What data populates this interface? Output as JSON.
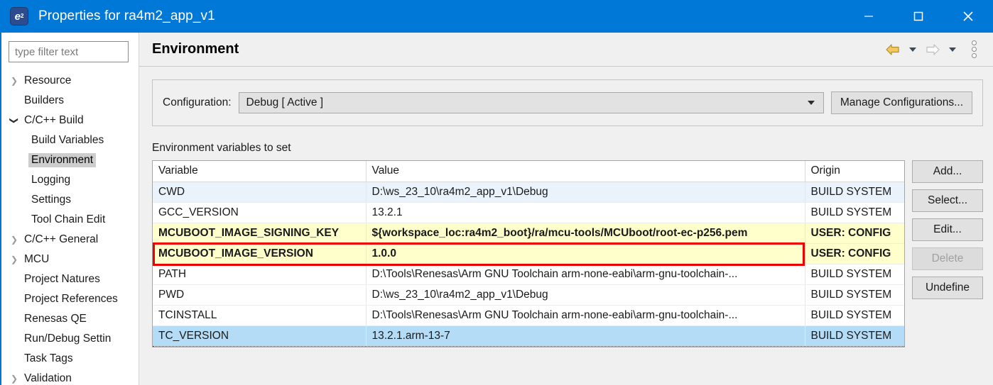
{
  "window": {
    "title": "Properties for ra4m2_app_v1",
    "app_icon": "eclipse-icon",
    "minimize_label": "Minimize",
    "maximize_label": "Maximize",
    "close_label": "Close"
  },
  "sidebar": {
    "filter": {
      "placeholder": "type filter text",
      "value": ""
    },
    "items": [
      {
        "label": "Resource",
        "level": 1,
        "arrow": "collapsed",
        "selected": false
      },
      {
        "label": "Builders",
        "level": 1,
        "arrow": "none",
        "selected": false
      },
      {
        "label": "C/C++ Build",
        "level": 1,
        "arrow": "expanded",
        "selected": false
      },
      {
        "label": "Build Variables",
        "level": 2,
        "arrow": "none",
        "selected": false
      },
      {
        "label": "Environment",
        "level": 2,
        "arrow": "none",
        "selected": true
      },
      {
        "label": "Logging",
        "level": 2,
        "arrow": "none",
        "selected": false
      },
      {
        "label": "Settings",
        "level": 2,
        "arrow": "none",
        "selected": false
      },
      {
        "label": "Tool Chain Edit",
        "level": 2,
        "arrow": "none",
        "selected": false
      },
      {
        "label": "C/C++ General",
        "level": 1,
        "arrow": "collapsed",
        "selected": false
      },
      {
        "label": "MCU",
        "level": 1,
        "arrow": "collapsed",
        "selected": false
      },
      {
        "label": "Project Natures",
        "level": 1,
        "arrow": "none",
        "selected": false
      },
      {
        "label": "Project References",
        "level": 1,
        "arrow": "none",
        "selected": false
      },
      {
        "label": "Renesas QE",
        "level": 1,
        "arrow": "none",
        "selected": false
      },
      {
        "label": "Run/Debug Settin",
        "level": 1,
        "arrow": "none",
        "selected": false
      },
      {
        "label": "Task Tags",
        "level": 1,
        "arrow": "none",
        "selected": false
      },
      {
        "label": "Validation",
        "level": 1,
        "arrow": "collapsed",
        "selected": false
      }
    ]
  },
  "header": {
    "title": "Environment",
    "back_icon": "back-arrow-icon",
    "forward_icon": "forward-arrow-icon",
    "menu_icon": "vertical-dots-icon"
  },
  "configuration": {
    "label": "Configuration:",
    "selected": "Debug  [ Active ]",
    "options": [
      "Debug  [ Active ]"
    ],
    "manage_button": "Manage Configurations..."
  },
  "table": {
    "caption": "Environment variables to set",
    "columns": [
      "Variable",
      "Value",
      "Origin"
    ],
    "rows": [
      {
        "variable": "CWD",
        "value": "D:\\ws_23_10\\ra4m2_app_v1\\Debug",
        "origin": "BUILD SYSTEM",
        "style": "alt"
      },
      {
        "variable": "GCC_VERSION",
        "value": "13.2.1",
        "origin": "BUILD SYSTEM",
        "style": "normal"
      },
      {
        "variable": "MCUBOOT_IMAGE_SIGNING_KEY",
        "value": "${workspace_loc:ra4m2_boot}/ra/mcu-tools/MCUboot/root-ec-p256.pem",
        "origin": "USER: CONFIG",
        "style": "user"
      },
      {
        "variable": "MCUBOOT_IMAGE_VERSION",
        "value": "1.0.0",
        "origin": "USER: CONFIG",
        "style": "user"
      },
      {
        "variable": "PATH",
        "value": "D:\\Tools\\Renesas\\Arm GNU Toolchain arm-none-eabi\\arm-gnu-toolchain-...",
        "origin": "BUILD SYSTEM",
        "style": "normal"
      },
      {
        "variable": "PWD",
        "value": "D:\\ws_23_10\\ra4m2_app_v1\\Debug",
        "origin": "BUILD SYSTEM",
        "style": "normal"
      },
      {
        "variable": "TCINSTALL",
        "value": "D:\\Tools\\Renesas\\Arm GNU Toolchain arm-none-eabi\\arm-gnu-toolchain-...",
        "origin": "BUILD SYSTEM",
        "style": "normal"
      },
      {
        "variable": "TC_VERSION",
        "value": "13.2.1.arm-13-7",
        "origin": "BUILD SYSTEM",
        "style": "selected"
      }
    ]
  },
  "actions": {
    "add": "Add...",
    "select": "Select...",
    "edit": "Edit...",
    "delete": "Delete",
    "undefine": "Undefine"
  },
  "annotation": {
    "highlight_color": "#ee0000",
    "target_row": "MCUBOOT_IMAGE_VERSION"
  }
}
